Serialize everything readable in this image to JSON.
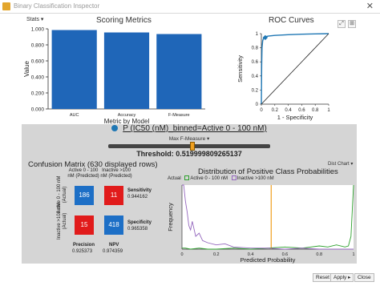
{
  "window": {
    "title": "Binary Classification Inspector",
    "close_glyph": "✕"
  },
  "stats_menu": {
    "label": "Stats"
  },
  "scoring": {
    "title": "Scoring Metrics",
    "chart_data": {
      "type": "bar",
      "title": "Scoring Metrics",
      "categories": [
        "AUC",
        "Accuracy",
        "F-Measure"
      ],
      "values": [
        0.985,
        0.955,
        0.935
      ],
      "xlabel": "Metric by Model",
      "ylabel": "Value",
      "ylim": [
        0,
        1
      ],
      "yticks": [
        "0.000",
        "0.200",
        "0.400",
        "0.600",
        "0.800",
        "1.000"
      ],
      "color": "#1f66b8",
      "grid": false
    }
  },
  "roc": {
    "title": "ROC Curves",
    "chart_data": {
      "type": "line",
      "title": "ROC Curves",
      "xlabel": "1 - Specificity",
      "ylabel": "Sensitivity",
      "xlim": [
        0,
        1
      ],
      "ylim": [
        0,
        1
      ],
      "xticks": [
        "0",
        "0.2",
        "0.4",
        "0.6",
        "0.8",
        "1"
      ],
      "yticks": [
        "0",
        "0.2",
        "0.4",
        "0.6",
        "0.8",
        "1"
      ],
      "series": [
        {
          "x": [
            0,
            0.005,
            0.01,
            0.02,
            0.035,
            0.06,
            0.1,
            0.2,
            0.4,
            0.6,
            0.8,
            1.0
          ],
          "y": [
            0,
            0.55,
            0.8,
            0.9,
            0.94,
            0.955,
            0.965,
            0.975,
            0.985,
            0.992,
            0.997,
            1.0
          ],
          "color": "#1f77b4"
        },
        {
          "x": [
            0,
            1
          ],
          "y": [
            0,
            1
          ],
          "color": "#222222"
        }
      ],
      "marker": {
        "x": 0.058,
        "y": 0.944
      },
      "grid": false
    }
  },
  "roc_tools": {
    "expand": "⤢",
    "zoom": "⊞"
  },
  "target": {
    "label": "P (IC50 (nM)_binned=Active 0 - 100 nM)",
    "color": "#1f77b4"
  },
  "optimizer": {
    "label": "Max F-Measure",
    "threshold_fraction": 0.52
  },
  "threshold": {
    "label": "Threshold:",
    "value": "0.519999809265137"
  },
  "confusion": {
    "title": "Confusion Matrix (630 displayed rows)",
    "col_headers": [
      "Active 0 - 100 nM (Predicted)",
      "Inactive >100 nM (Predicted)"
    ],
    "row_headers": [
      "Active 0 - 100 nM (Actual)",
      "Inactive >100 nM (Actual)"
    ],
    "cells": [
      [
        "186",
        "11"
      ],
      [
        "15",
        "418"
      ]
    ],
    "sensitivity": {
      "name": "Sensitivity",
      "value": "0.944162"
    },
    "specificity": {
      "name": "Specificity",
      "value": "0.965358"
    },
    "precision": {
      "name": "Precision",
      "value": "0.925373"
    },
    "npv": {
      "name": "NPV",
      "value": "0.974359"
    }
  },
  "distribution": {
    "title": "Distribution of Positive Class Probabilities",
    "menu_label": "Dist Chart",
    "legend_prefix": "Actual",
    "chart_data": {
      "type": "line",
      "title": "Distribution of Positive Class Probabilities",
      "xlabel": "Predicted Probability",
      "ylabel": "Frequency",
      "xlim": [
        0,
        1
      ],
      "xticks": [
        "0",
        "0.2",
        "0.4",
        "0.6",
        "0.8",
        "1"
      ],
      "threshold_x": 0.52,
      "series": [
        {
          "name": "Active 0 - 100 nM",
          "color": "#2ca02c",
          "x": [
            0,
            0.02,
            0.05,
            0.1,
            0.15,
            0.2,
            0.3,
            0.4,
            0.5,
            0.6,
            0.7,
            0.8,
            0.85,
            0.9,
            0.95,
            0.97,
            0.985,
            1.0
          ],
          "y": [
            1,
            1,
            0,
            1,
            0,
            0,
            1,
            0,
            1,
            2,
            1,
            3,
            2,
            4,
            2,
            3,
            12,
            60
          ]
        },
        {
          "name": "Inactive >100 nM",
          "color": "#9467bd",
          "x": [
            0,
            0.005,
            0.01,
            0.02,
            0.03,
            0.04,
            0.05,
            0.06,
            0.08,
            0.1,
            0.12,
            0.15,
            0.2,
            0.25,
            0.3,
            0.4,
            0.5,
            0.6,
            0.7,
            0.8,
            0.9,
            1.0
          ],
          "y": [
            200,
            120,
            70,
            45,
            35,
            22,
            18,
            26,
            12,
            15,
            8,
            6,
            4,
            5,
            2,
            1,
            1,
            0,
            1,
            0,
            0,
            0
          ]
        }
      ],
      "grid": false
    }
  },
  "footer": {
    "reset": "Reset",
    "apply": "Apply",
    "close": "Close"
  }
}
